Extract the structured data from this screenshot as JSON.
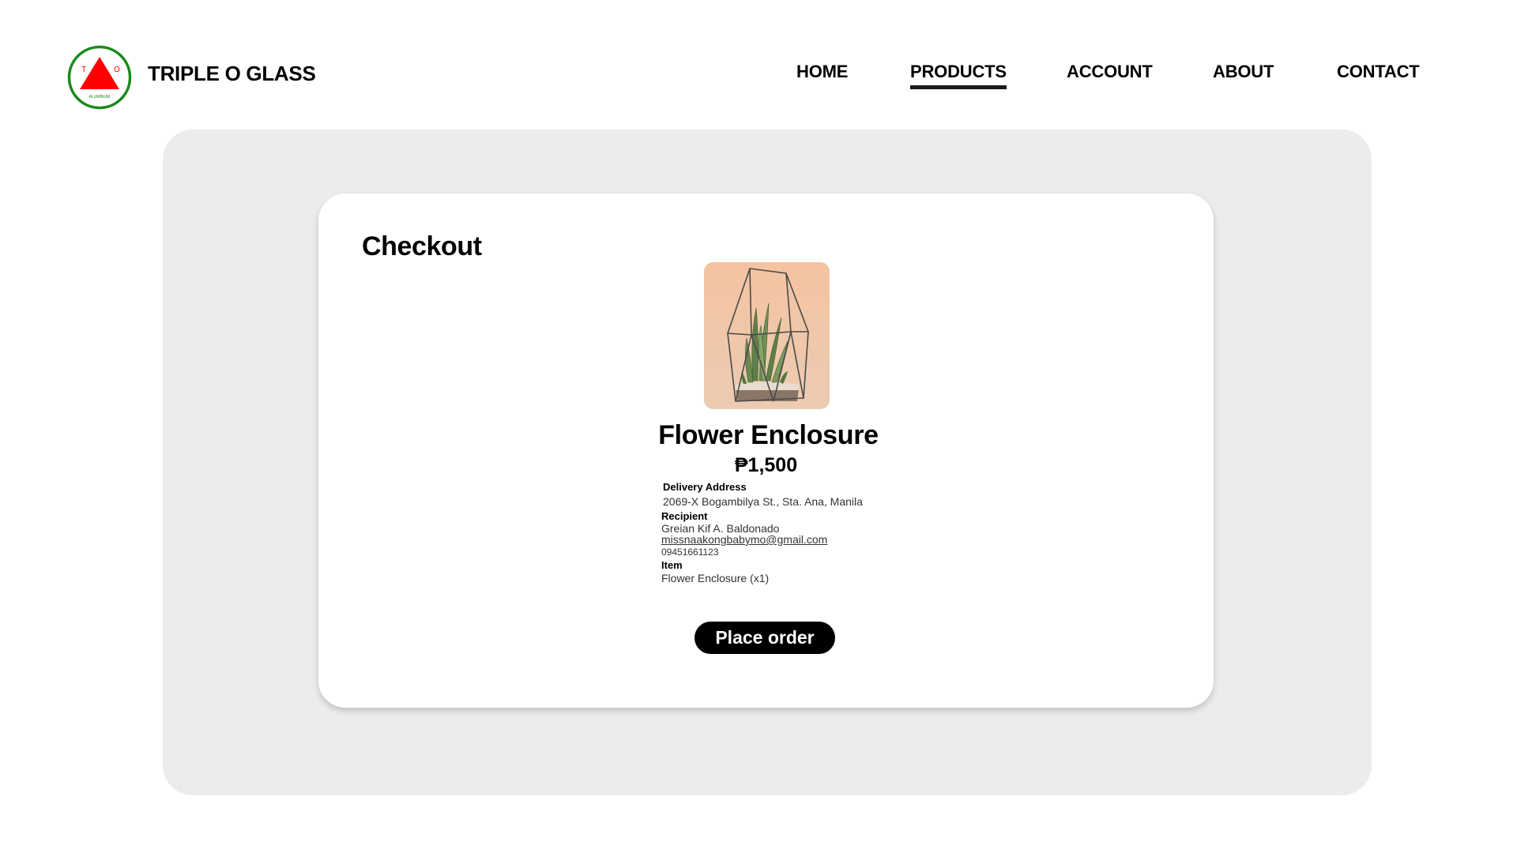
{
  "brand": {
    "name": "TRIPLE O GLASS",
    "logo_letters": [
      "T",
      "O"
    ],
    "logo_subtext": "ALUMINUM",
    "logo_colors": {
      "ring": "#1a8a1a",
      "triangle": "#ff0000"
    }
  },
  "nav": {
    "items": [
      {
        "label": "HOME",
        "active": false
      },
      {
        "label": "PRODUCTS",
        "active": true
      },
      {
        "label": "ACCOUNT",
        "active": false
      },
      {
        "label": "ABOUT",
        "active": false
      },
      {
        "label": "CONTACT",
        "active": false
      }
    ]
  },
  "checkout": {
    "title": "Checkout",
    "product": {
      "name": "Flower Enclosure",
      "price": "₱1,500",
      "image_description": "terrarium-plant-image"
    },
    "delivery_address_label": "Delivery Address",
    "delivery_address": "2069-X Bogambilya St., Sta. Ana, Manila",
    "recipient_label": "Recipient",
    "recipient_name": "Greian Kif A. Baldonado",
    "recipient_email": "missnaakongbabymo@gmail.com",
    "recipient_phone": "09451661123",
    "item_label": "Item",
    "item_value": "Flower Enclosure (x1)",
    "place_order_label": "Place order"
  },
  "colors": {
    "panel_bg": "#ececec",
    "card_bg": "#ffffff",
    "button_bg": "#000000",
    "button_text": "#ffffff"
  }
}
